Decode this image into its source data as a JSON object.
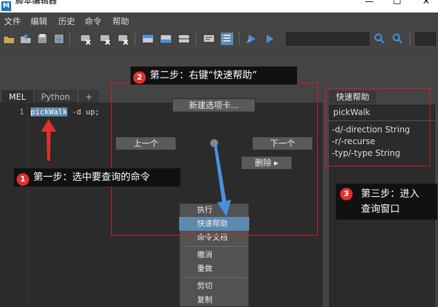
{
  "window": {
    "title": "脚本编辑器",
    "app_icon": "M",
    "controls": {
      "minimize": "—",
      "maximize": "☐",
      "close": "✕"
    }
  },
  "menu": [
    "文件",
    "编辑",
    "历史",
    "命令",
    "帮助"
  ],
  "toolbar": {
    "icons": [
      "open-script-icon",
      "load-script-icon",
      "save-script-icon",
      "save-script-to-shelf-icon",
      "clear-history-icon",
      "clear-input-icon",
      "clear-all-icon",
      "show-history-icon",
      "show-input-icon",
      "show-both-icon",
      "echo-all-commands-icon",
      "show-line-numbers-icon",
      "execute-all-icon",
      "execute-icon",
      "search-icon",
      "search-next-icon"
    ],
    "search_value": ""
  },
  "tabs": [
    "MEL",
    "Python",
    "+"
  ],
  "editor": {
    "line_number": "1",
    "selected_text": "pickWalk",
    "rest_text": " -d up;"
  },
  "marking_menu": {
    "new_tab": "新建选项卡...",
    "prev": "上一个",
    "next": "下一个",
    "delete": "删除",
    "delete_arrow": "▸"
  },
  "context_menu": {
    "items_group1": [
      "执行",
      "快速帮助",
      "命令文档"
    ],
    "items_group2": [
      "撤消",
      "重做"
    ],
    "items_group3": [
      "剪切",
      "复制"
    ],
    "highlighted": "快速帮助"
  },
  "quick_help": {
    "tab_label": "快速帮助",
    "command": "pickWalk",
    "flags": [
      "-d/-direction String",
      "-r/-recurse",
      "-typ/-type String"
    ]
  },
  "annotations": {
    "step1": {
      "num": "1",
      "text": "第一步：选中要查询的命令"
    },
    "step2": {
      "num": "2",
      "text": "第二步：右键“快速帮助”"
    },
    "step3": {
      "num": "3",
      "text": "第三步：进入查询窗口",
      "line1": "第三步：进入",
      "line2": "查询窗口"
    }
  },
  "colors": {
    "annotation_red": "#d21f1f",
    "arrow_blue": "#4a8fe0",
    "selection_blue": "#5e89ae"
  }
}
